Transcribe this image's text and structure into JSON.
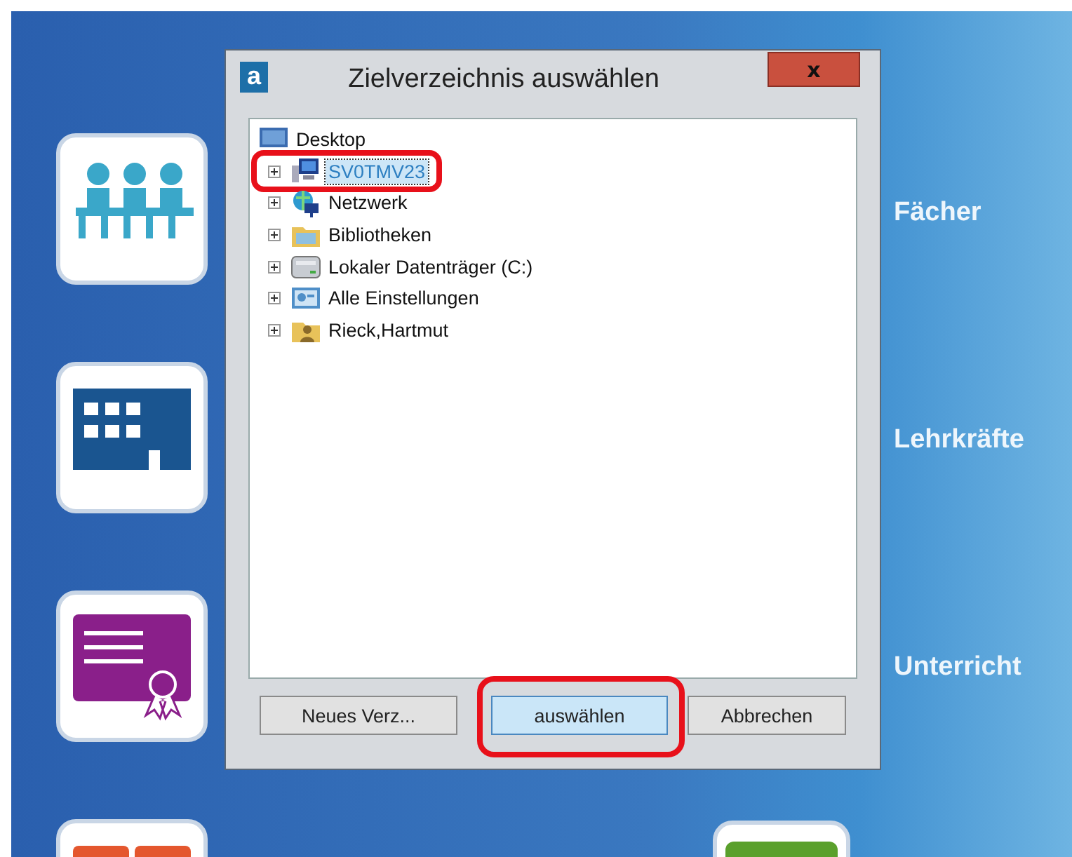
{
  "desktop": {
    "tiles": [
      {
        "kind": "group"
      },
      {
        "kind": "building"
      },
      {
        "kind": "certificate"
      },
      {
        "kind": "orange"
      }
    ],
    "labels": [
      "Fächer",
      "Lehrkräfte",
      "Unterricht"
    ],
    "corner_tile": {
      "kind": "green"
    }
  },
  "window": {
    "app_icon": "a",
    "title": "Zielverzeichnis auswählen",
    "close": "x"
  },
  "tree": {
    "root": {
      "label": "Desktop",
      "kind": "desktop",
      "selected": false,
      "children": [
        {
          "label": "SV0TMV23",
          "kind": "computer",
          "expanded": false,
          "selected": true,
          "highlighted": true
        },
        {
          "label": "Netzwerk",
          "kind": "network",
          "expanded": false,
          "selected": false,
          "highlighted": false
        },
        {
          "label": "Bibliotheken",
          "kind": "library",
          "expanded": false,
          "selected": false,
          "highlighted": false
        },
        {
          "label": "Lokaler Datenträger (C:)",
          "kind": "drive",
          "expanded": false,
          "selected": false,
          "highlighted": false
        },
        {
          "label": "Alle Einstellungen",
          "kind": "settings",
          "expanded": false,
          "selected": false,
          "highlighted": false
        },
        {
          "label": "Rieck,Hartmut",
          "kind": "user",
          "expanded": false,
          "selected": false,
          "highlighted": false
        }
      ]
    }
  },
  "buttons": [
    {
      "label": "Neues Verz...",
      "default": false,
      "highlighted": false
    },
    {
      "label": "auswählen",
      "default": true,
      "highlighted": true
    },
    {
      "label": "Abbrechen",
      "default": false,
      "highlighted": false
    }
  ]
}
